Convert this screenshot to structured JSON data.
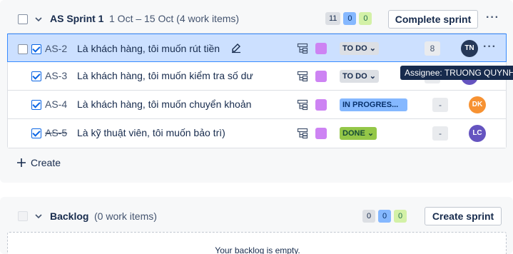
{
  "sprint": {
    "name": "AS Sprint 1",
    "meta": "1 Oct – 15 Oct (4 work items)",
    "counts": {
      "todo": "11",
      "in_progress": "0",
      "done": "0"
    },
    "complete_label": "Complete sprint",
    "more_label": "···",
    "issues": [
      {
        "key": "AS-2",
        "summary": "Là khách hàng, tôi muốn rút tiền",
        "status": "TO DO",
        "estimate": "8",
        "assignee": "TN",
        "assignee_color": "#253858",
        "more": "···"
      },
      {
        "key": "AS-3",
        "summary": "Là khách hàng, tôi muốn kiểm tra số dư",
        "status": "TO DO",
        "estimate": "-",
        "assignee": "",
        "assignee_color": "#6554c0"
      },
      {
        "key": "AS-4",
        "summary": "Là khách hàng, tôi muốn chuyển khoản",
        "status": "IN PROGRES...",
        "estimate": "-",
        "assignee": "DK",
        "assignee_color": "#f79232"
      },
      {
        "key": "AS-5",
        "summary": "Là kỹ thuật viên, tôi muốn bảo trì)",
        "status": "DONE",
        "estimate": "-",
        "assignee": "LC",
        "assignee_color": "#6554c0"
      }
    ],
    "tooltip": "Assignee: TRUONG QUYNH",
    "create_label": "Create"
  },
  "backlog": {
    "name": "Backlog",
    "meta": "(0 work items)",
    "counts": {
      "todo": "0",
      "in_progress": "0",
      "done": "0"
    },
    "create_sprint_label": "Create sprint",
    "empty_text": "Your backlog is empty."
  },
  "colors": {
    "accent": "#0c66e4",
    "selected_row": "#cce0ff",
    "epic": "#cd83f3"
  },
  "icons": {
    "chevron": "chevron-down-icon",
    "subtask": "child-issues-icon",
    "edit": "edit-icon",
    "plus": "plus-icon"
  }
}
